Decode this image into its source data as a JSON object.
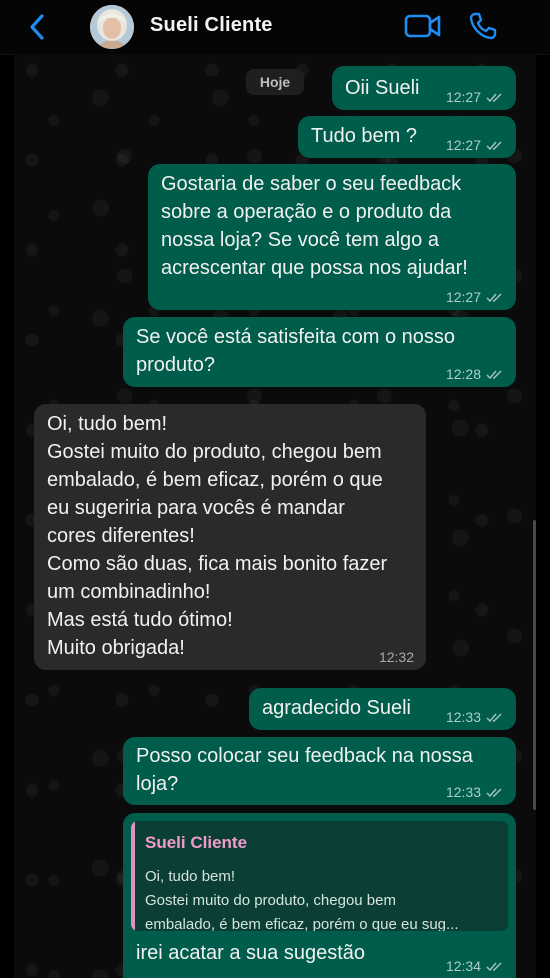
{
  "header": {
    "back_icon": "chevron-left-icon",
    "contact_name": "Sueli Cliente",
    "video_icon": "video-camera-icon",
    "phone_icon": "phone-icon",
    "accent_color": "#1e8cf0"
  },
  "chat": {
    "date_chip": "Hoje",
    "messages": [
      {
        "dir": "out",
        "lines": [
          "Oii Sueli"
        ],
        "time": "12:27",
        "read": true
      },
      {
        "dir": "out",
        "lines": [
          "Tudo bem ?"
        ],
        "time": "12:27",
        "read": true
      },
      {
        "dir": "out",
        "lines": [
          "Gostaria de saber o seu feedback",
          "sobre a operação e o produto da",
          "nossa loja? Se você tem algo a",
          "acrescentar que possa nos ajudar!"
        ],
        "time": "12:27",
        "read": true
      },
      {
        "dir": "out",
        "lines": [
          "Se você está satisfeita com o nosso",
          "produto?"
        ],
        "time": "12:28",
        "read": true
      },
      {
        "dir": "in",
        "lines": [
          "Oi, tudo bem!",
          "Gostei muito do produto, chegou bem",
          "embalado, é bem eficaz, porém o que",
          "eu sugeriria para vocês é mandar",
          "cores diferentes!",
          "Como são duas, fica mais bonito fazer",
          "um combinadinho!",
          "Mas está tudo ótimo!",
          "Muito obrigada!"
        ],
        "time": "12:32"
      },
      {
        "dir": "out",
        "lines": [
          "agradecido Sueli"
        ],
        "time": "12:33",
        "read": true
      },
      {
        "dir": "out",
        "lines": [
          "Posso colocar seu feedback na nossa",
          "loja?"
        ],
        "time": "12:33",
        "read": true
      },
      {
        "dir": "out",
        "quote": {
          "author": "Sueli Cliente",
          "lines": [
            "Oi, tudo bem!",
            "Gostei muito do produto, chegou bem",
            "embalado, é bem eficaz, porém o que eu sug..."
          ]
        },
        "lines": [
          "irei acatar a sua sugestão"
        ],
        "time": "12:34",
        "read": true
      }
    ]
  },
  "colors": {
    "outgoing_bubble": "#005c4b",
    "incoming_bubble": "#2a2a2a",
    "quote_author": "#f09ccb",
    "read_ticks": "#9fc2bb"
  }
}
